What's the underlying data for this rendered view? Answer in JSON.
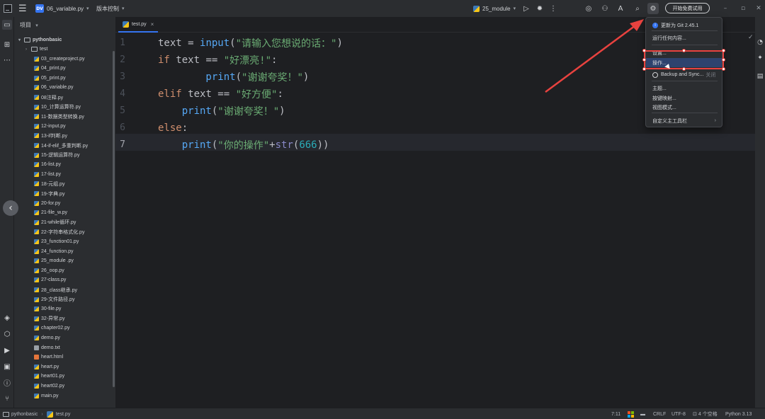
{
  "titlebar": {
    "project_badge": "DV",
    "project_name": "06_variable.py",
    "vcs_label": "版本控制",
    "run_config": "25_module",
    "trial_button": "开始免费试用"
  },
  "project_panel": {
    "header": "项目",
    "root": "pythonbasic",
    "items": [
      {
        "name": "test",
        "kind": "folder"
      },
      {
        "name": "03_createproject.py",
        "kind": "py"
      },
      {
        "name": "04_print.py",
        "kind": "py"
      },
      {
        "name": "05_print.py",
        "kind": "py"
      },
      {
        "name": "06_variable.py",
        "kind": "py"
      },
      {
        "name": "08注释.py",
        "kind": "py"
      },
      {
        "name": "10_计算运算符.py",
        "kind": "py"
      },
      {
        "name": "11-数据类型转换.py",
        "kind": "py"
      },
      {
        "name": "12-input.py",
        "kind": "py"
      },
      {
        "name": "13-if判断.py",
        "kind": "py"
      },
      {
        "name": "14-if-elif_多重判断.py",
        "kind": "py"
      },
      {
        "name": "15-逻辑运算符.py",
        "kind": "py"
      },
      {
        "name": "16-list.py",
        "kind": "py"
      },
      {
        "name": "17-list.py",
        "kind": "py"
      },
      {
        "name": "18-元组.py",
        "kind": "py"
      },
      {
        "name": "19-字典.py",
        "kind": "py"
      },
      {
        "name": "20-for.py",
        "kind": "py"
      },
      {
        "name": "21-file_w.py",
        "kind": "py"
      },
      {
        "name": "21-while循环.py",
        "kind": "py"
      },
      {
        "name": "22-字符串格式化.py",
        "kind": "py"
      },
      {
        "name": "23_function01.py",
        "kind": "py"
      },
      {
        "name": "24_function.py",
        "kind": "py"
      },
      {
        "name": "25_module .py",
        "kind": "py"
      },
      {
        "name": "26_oop.py",
        "kind": "py"
      },
      {
        "name": "27-class.py",
        "kind": "py"
      },
      {
        "name": "28_class继承.py",
        "kind": "py"
      },
      {
        "name": "29-文件路径.py",
        "kind": "py"
      },
      {
        "name": "30-file.py",
        "kind": "py"
      },
      {
        "name": "32-异常.py",
        "kind": "py"
      },
      {
        "name": "chapter02.py",
        "kind": "py"
      },
      {
        "name": "demo.py",
        "kind": "py"
      },
      {
        "name": "demo.txt",
        "kind": "txt"
      },
      {
        "name": "heart.html",
        "kind": "html"
      },
      {
        "name": "heart.py",
        "kind": "py"
      },
      {
        "name": "heart01.py",
        "kind": "py"
      },
      {
        "name": "heart02.py",
        "kind": "py"
      },
      {
        "name": "main.py",
        "kind": "py"
      }
    ]
  },
  "editor": {
    "tab": "test.py",
    "line_numbers": [
      "1",
      "2",
      "3",
      "4",
      "5",
      "6",
      "7"
    ],
    "current_line": 7,
    "lines": [
      [
        {
          "t": "text = ",
          "c": "plain"
        },
        {
          "t": "input",
          "c": "fn"
        },
        {
          "t": "(",
          "c": "plain"
        },
        {
          "t": "\"请输入您想说的话：\"",
          "c": "str"
        },
        {
          "t": ")",
          "c": "plain"
        }
      ],
      [
        {
          "t": "if ",
          "c": "kw"
        },
        {
          "t": "text == ",
          "c": "plain"
        },
        {
          "t": "\"好漂亮!\"",
          "c": "str"
        },
        {
          "t": ":",
          "c": "plain"
        }
      ],
      [
        {
          "t": "        print",
          "c": "fn"
        },
        {
          "t": "(",
          "c": "plain"
        },
        {
          "t": "\"谢谢夸奖！\"",
          "c": "str"
        },
        {
          "t": ")",
          "c": "plain"
        }
      ],
      [
        {
          "t": "elif ",
          "c": "kw"
        },
        {
          "t": "text == ",
          "c": "plain"
        },
        {
          "t": "\"好方便\"",
          "c": "str"
        },
        {
          "t": ":",
          "c": "plain"
        }
      ],
      [
        {
          "t": "    print",
          "c": "fn"
        },
        {
          "t": "(",
          "c": "plain"
        },
        {
          "t": "\"谢谢夸奖！\"",
          "c": "str"
        },
        {
          "t": ")",
          "c": "plain"
        }
      ],
      [
        {
          "t": "else",
          "c": "kw"
        },
        {
          "t": ":",
          "c": "plain"
        }
      ],
      [
        {
          "t": "    print",
          "c": "fn"
        },
        {
          "t": "(",
          "c": "plain"
        },
        {
          "t": "\"你的操作\"",
          "c": "str"
        },
        {
          "t": "+",
          "c": "plain"
        },
        {
          "t": "str",
          "c": "bi"
        },
        {
          "t": "(",
          "c": "plain"
        },
        {
          "t": "666",
          "c": "num"
        },
        {
          "t": "))",
          "c": "plain"
        }
      ]
    ]
  },
  "menu": {
    "items": [
      {
        "label": "更新为 Git 2.45.1",
        "icon": "info-icon"
      },
      {
        "label": "运行任何内容...",
        "icon": ""
      },
      {
        "label": "设置...",
        "icon": ""
      },
      {
        "label": "操作...",
        "icon": "",
        "selected": true
      },
      {
        "label": "Backup and Sync...",
        "icon": "ban-icon",
        "extra": "关闭"
      },
      {
        "label": "主题...",
        "icon": ""
      },
      {
        "label": "按键映射...",
        "icon": ""
      },
      {
        "label": "视图模式...",
        "icon": ""
      },
      {
        "label": "自定义主工具栏",
        "icon": "",
        "submenu": true
      }
    ]
  },
  "statusbar": {
    "breadcrumb_root": "pythonbasic",
    "breadcrumb_file": "test.py",
    "position": "7:11",
    "line_sep": "CRLF",
    "encoding": "UTF-8",
    "indent": "4 个空格",
    "interpreter": "Python 3.13"
  },
  "colors": {
    "accent": "#3574f0",
    "annotation": "#e8423f",
    "background": "#1e1f22",
    "panel": "#2b2d30"
  }
}
